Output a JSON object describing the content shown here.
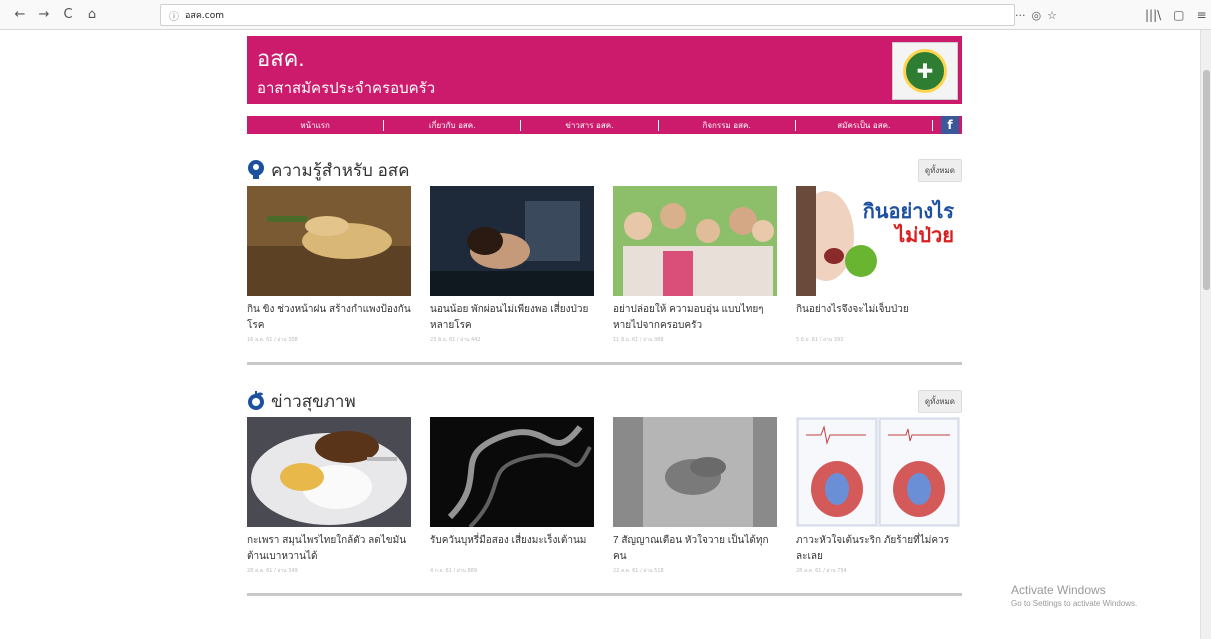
{
  "browser": {
    "url": "อสค.com",
    "back": "←",
    "forward": "→",
    "reload": "C",
    "home": "⌂",
    "info": "ⓘ",
    "more": "···",
    "pocket": "◎",
    "star": "☆",
    "library": "|||\\",
    "sidebar": "▢",
    "menu": "≡"
  },
  "header": {
    "title": "อสค.",
    "subtitle": "อาสาสมัครประจำครอบครัว"
  },
  "nav": {
    "items": [
      "หน้าแรก",
      "เกี่ยวกับ อสค.",
      "ข่าวสาร อสค.",
      "กิจกรรม อสค.",
      "สมัครเป็น อสค."
    ],
    "fb": "f"
  },
  "sections": [
    {
      "title": "ความรู้สำหรับ อสค",
      "see_all": "ดูทั้งหมด",
      "cards": [
        {
          "title": "กิน ขิง ช่วงหน้าฝน สร้างกำแพงป้องกันโรค",
          "meta": "16 ส.ค. 61 / อ่าน 308"
        },
        {
          "title": "นอนน้อย พักผ่อนไม่เพียงพอ เสี่ยงป่วยหลายโรค",
          "meta": "23 มิ.ย. 61 / อ่าน 442"
        },
        {
          "title": "อย่าปล่อยให้ ความอบอุ่น แบบไทยๆ หายไปจากครอบครัว",
          "meta": "11 มิ.ย. 61 / อ่าน 388"
        },
        {
          "title": "กินอย่างไรจึงจะไม่เจ็บป่วย",
          "meta": "5 มิ.ย. 61 / อ่าน 393"
        }
      ],
      "card4_overlay": [
        "กินอย่างไร",
        "ไม่ป่วย"
      ]
    },
    {
      "title": "ข่าวสุขภาพ",
      "see_all": "ดูทั้งหมด",
      "cards": [
        {
          "title": "กะเพรา สมุนไพรไทยใกล้ตัว ลดไขมัน ต้านเบาหวานได้",
          "meta": "28 ส.ค. 61 / อ่าน 349"
        },
        {
          "title": "รับควันบุหรี่มือสอง เสี่ยงมะเร็งเต้านม",
          "meta": "4 ก.ย. 61 / อ่าน 889"
        },
        {
          "title": "7 สัญญาณเตือน หัวใจวาย เป็นได้ทุกคน",
          "meta": "22 ส.ค. 61 / อ่าน 518"
        },
        {
          "title": "ภาวะหัวใจเต้นระริก ภัยร้ายที่ไม่ควรละเลย",
          "meta": "28 ส.ค. 61 / อ่าน 754"
        }
      ]
    }
  ],
  "activate": {
    "line1": "Activate Windows",
    "line2": "Go to Settings to activate Windows."
  }
}
